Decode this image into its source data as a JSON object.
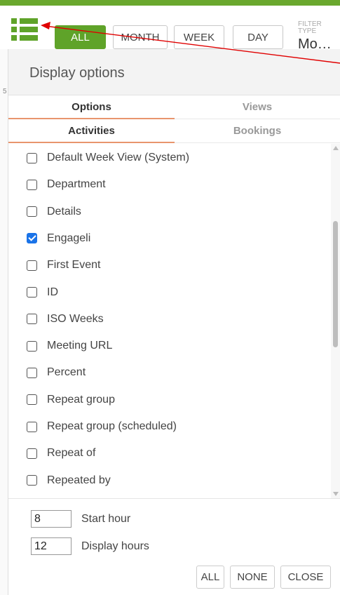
{
  "toolbar": {
    "buttons": {
      "all": "ALL",
      "month": "MONTH",
      "week": "WEEK",
      "day": "DAY"
    },
    "filter_label": "FILTER TYPE",
    "filter_value": "Mo…"
  },
  "panel": {
    "title": "Display options",
    "tabs_row1": {
      "options": "Options",
      "views": "Views"
    },
    "tabs_row2": {
      "activities": "Activities",
      "bookings": "Bookings"
    },
    "items": [
      {
        "label": "Default Week View (System)",
        "checked": false
      },
      {
        "label": "Department",
        "checked": false
      },
      {
        "label": "Details",
        "checked": false
      },
      {
        "label": "Engageli",
        "checked": true
      },
      {
        "label": "First Event",
        "checked": false
      },
      {
        "label": "ID",
        "checked": false
      },
      {
        "label": "ISO Weeks",
        "checked": false
      },
      {
        "label": "Meeting URL",
        "checked": false
      },
      {
        "label": "Percent",
        "checked": false
      },
      {
        "label": "Repeat group",
        "checked": false
      },
      {
        "label": "Repeat group (scheduled)",
        "checked": false
      },
      {
        "label": "Repeat of",
        "checked": false
      },
      {
        "label": "Repeated by",
        "checked": false
      }
    ],
    "start_hour": {
      "value": "8",
      "label": "Start hour"
    },
    "display_hours": {
      "value": "12",
      "label": "Display hours"
    },
    "footer_buttons": {
      "all": "ALL",
      "none": "NONE",
      "close": "CLOSE"
    }
  },
  "colors": {
    "accent": "#5fa329",
    "tab_underline": "#e8956d",
    "checkbox_on": "#1a73e8",
    "annotation_arrow": "#e00000"
  },
  "left_strip_mark": "5"
}
